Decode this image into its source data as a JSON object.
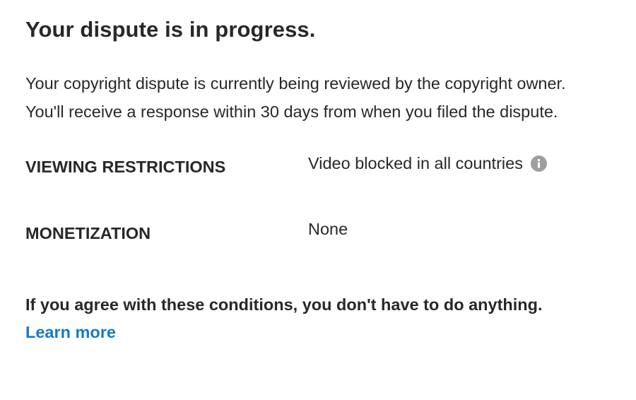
{
  "header": {
    "title": "Your dispute is in progress."
  },
  "description": {
    "line1": "Your copyright dispute is currently being reviewed by the copyright owner.",
    "line2": "You'll receive a response within 30 days from when you filed the dispute."
  },
  "restrictions": [
    {
      "label": "VIEWING RESTRICTIONS",
      "value": "Video blocked in all countries",
      "icon": "info-icon"
    },
    {
      "label": "MONETIZATION",
      "value": "None"
    }
  ],
  "footer": {
    "note": "If you agree with these conditions, you don't have to do anything.",
    "learn_more_label": "Learn more"
  },
  "colors": {
    "text": "#282828",
    "link": "#167ac6",
    "icon": "#9e9e9e"
  }
}
